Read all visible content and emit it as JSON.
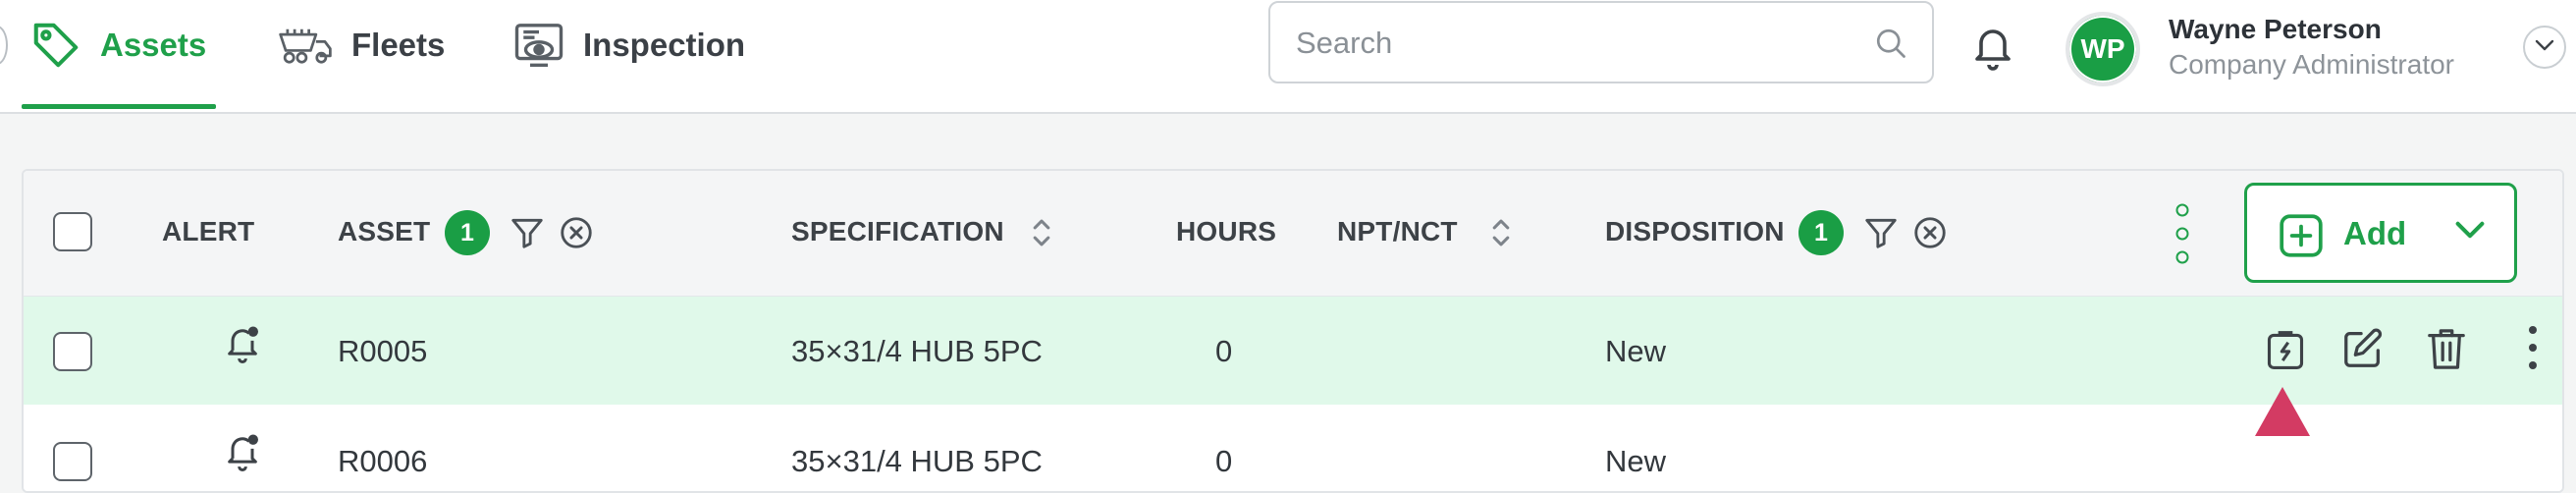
{
  "nav": {
    "tabs": [
      {
        "label": "Assets",
        "icon": "tag-icon",
        "active": true
      },
      {
        "label": "Fleets",
        "icon": "truck-icon",
        "active": false
      },
      {
        "label": "Inspection",
        "icon": "inspection-monitor-icon",
        "active": false
      }
    ],
    "accent_color": "#1fa04a"
  },
  "search": {
    "placeholder": "Search",
    "value": ""
  },
  "user": {
    "initials": "WP",
    "name": "Wayne Peterson",
    "role": "Company Administrator",
    "avatar_color": "#1a9e45"
  },
  "table": {
    "columns": {
      "alert": "ALERT",
      "asset": "ASSET",
      "asset_filter_count": "1",
      "specification": "SPECIFICATION",
      "hours": "HOURS",
      "npt_nct": "NPT/NCT",
      "disposition": "DISPOSITION",
      "disposition_filter_count": "1"
    },
    "add_button_label": "Add",
    "rows": [
      {
        "asset": "R0005",
        "specification": "35×31/4 HUB 5PC",
        "hours": "0",
        "npt_nct": "",
        "disposition": "New",
        "selected": true
      },
      {
        "asset": "R0006",
        "specification": "35×31/4 HUB 5PC",
        "hours": "0",
        "npt_nct": "",
        "disposition": "New",
        "selected": false
      }
    ],
    "row_actions": [
      "lightning-tag-icon",
      "edit-icon",
      "trash-icon",
      "more-vertical-icon"
    ],
    "selected_row_color": "#e0f9ea",
    "tooltip_arrow_color": "#d33b63"
  }
}
